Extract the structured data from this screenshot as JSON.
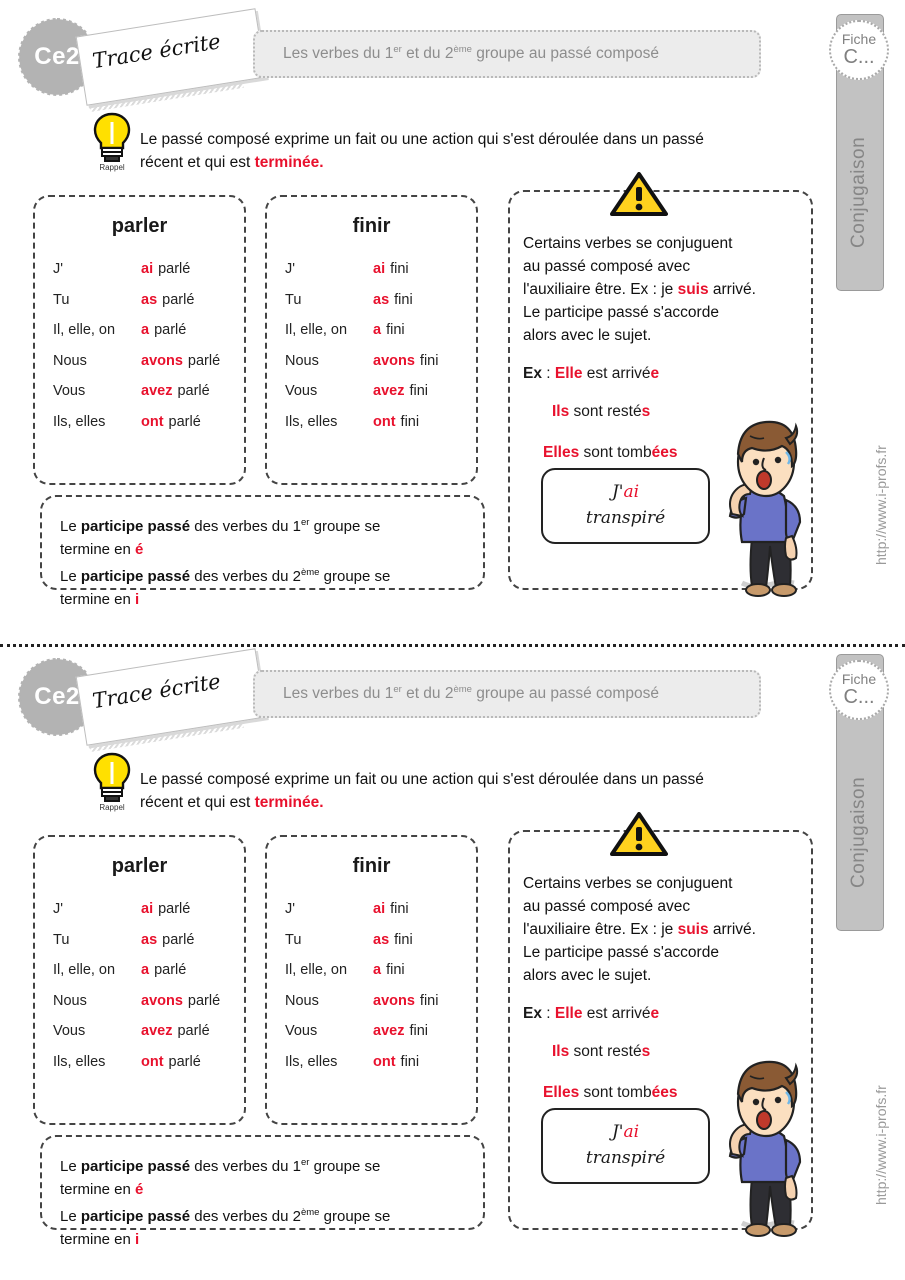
{
  "grade_badge": "Ce2",
  "trace_card": "Trace écrite",
  "title": {
    "before1": "Les verbes du ",
    "ord1_base": "1",
    "ord1_sup": "er",
    "between": " et du ",
    "ord2_base": "2",
    "ord2_sup": "ème",
    "after": " groupe au passé composé"
  },
  "tab": {
    "fiche_label": "Fiche",
    "fiche_value": "C...",
    "subject": "Conjugaison"
  },
  "url": "http://www.i-profs.fr",
  "rappel": {
    "icon_caption": "Rappel",
    "line1": "Le passé composé  exprime un fait ou une action qui s'est déroulée dans un passé",
    "line2_before": "récent  et qui est ",
    "line2_red": "terminée."
  },
  "verbs": [
    {
      "infinitive": "parler",
      "rows": [
        {
          "pronoun": "J'",
          "aux": "ai",
          "participle": "parlé"
        },
        {
          "pronoun": "Tu",
          "aux": "as",
          "participle": "parlé"
        },
        {
          "pronoun": "Il, elle, on",
          "aux": "a",
          "participle": "parlé"
        },
        {
          "pronoun": "Nous",
          "aux": "avons",
          "participle": "parlé"
        },
        {
          "pronoun": "Vous",
          "aux": "avez",
          "participle": "parlé"
        },
        {
          "pronoun": "Ils, elles",
          "aux": "ont",
          "participle": "parlé"
        }
      ]
    },
    {
      "infinitive": "finir",
      "rows": [
        {
          "pronoun": "J'",
          "aux": "ai",
          "participle": "fini"
        },
        {
          "pronoun": "Tu",
          "aux": "as",
          "participle": "fini"
        },
        {
          "pronoun": "Il, elle, on",
          "aux": "a",
          "participle": "fini"
        },
        {
          "pronoun": "Nous",
          "aux": "avons",
          "participle": "fini"
        },
        {
          "pronoun": "Vous",
          "aux": "avez",
          "participle": "fini"
        },
        {
          "pronoun": "Ils, elles",
          "aux": "ont",
          "participle": "fini"
        }
      ]
    }
  ],
  "participle_box": {
    "l1a": "Le ",
    "l1b": "participe passé",
    "l1c": " des verbes du ",
    "l1_ord": "1",
    "l1_sup": "er",
    "l1d": " groupe se",
    "l2a": "termine en ",
    "l2_red": "é",
    "l3a": "Le ",
    "l3b": "participe passé",
    "l3c": " des verbes du ",
    "l3_ord": "2",
    "l3_sup": "ème",
    "l3d": "  groupe se",
    "l4a": "termine en ",
    "l4_red": "i"
  },
  "warning": {
    "icon": "warning-triangle-icon",
    "p1": "Certains verbes se conjuguent",
    "p2": "au passé composé avec",
    "p3a": "l'auxiliaire être. Ex : je ",
    "p3_red": "suis",
    "p3b": " arrivé.",
    "p4": "Le participe passé s'accorde",
    "p5": "alors avec le sujet.",
    "ex_label": "Ex",
    "ex_sep": " : ",
    "ex1_red": "Elle",
    "ex1_mid": " est arrivé",
    "ex1_red_end": "e",
    "ex2_red": "Ils",
    "ex2_mid": " sont resté",
    "ex2_red_end": "s",
    "ex3_red": "Elles",
    "ex3_mid": " sont  tomb",
    "ex3_red_end": "ées"
  },
  "speech_bubble": {
    "line1_a": "J'",
    "line1_red": "ai",
    "line2": "transpiré"
  },
  "colors": {
    "accent_red": "#e8112d",
    "gray_tab": "#c2c2c2",
    "title_gray": "#8d8d8d",
    "bulb_yellow": "#ffe000",
    "shirt_blue": "#6a73c8"
  }
}
